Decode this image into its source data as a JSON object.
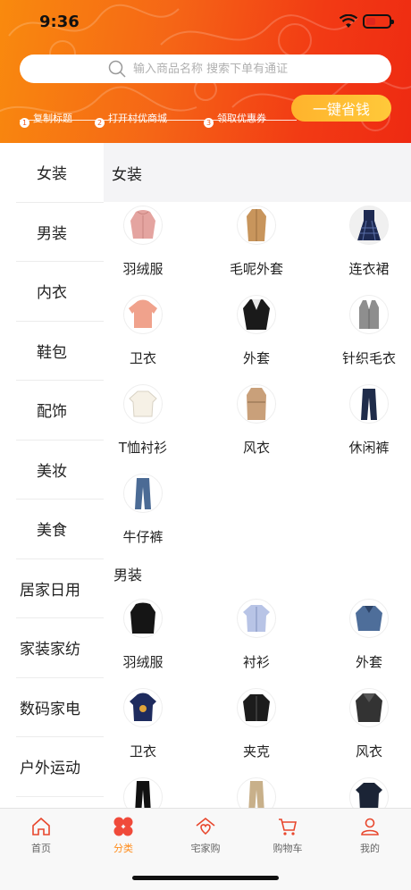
{
  "status": {
    "time": "9:36"
  },
  "search": {
    "placeholder": "输入商品名称 搜索下单有通证"
  },
  "steps": [
    {
      "num": "1",
      "label": "复制标题"
    },
    {
      "num": "2",
      "label": "打开村优商城"
    },
    {
      "num": "3",
      "label": "领取优惠券"
    }
  ],
  "save_button": "一键省钱",
  "sidebar": [
    "女装",
    "男装",
    "内衣",
    "鞋包",
    "配饰",
    "美妆",
    "美食",
    "居家日用",
    "家装家纺",
    "数码家电",
    "户外运动"
  ],
  "content": {
    "header": "女装",
    "sections": [
      {
        "title": "女装",
        "items": [
          {
            "label": "羽绒服",
            "icon": "pink-down-jacket-icon"
          },
          {
            "label": "毛呢外套",
            "icon": "camel-wool-coat-icon"
          },
          {
            "label": "连衣裙",
            "icon": "plaid-dress-icon"
          },
          {
            "label": "卫衣",
            "icon": "pink-hoodie-icon"
          },
          {
            "label": "外套",
            "icon": "black-jacket-icon"
          },
          {
            "label": "针织毛衣",
            "icon": "grey-knit-vest-icon"
          },
          {
            "label": "T恤衬衫",
            "icon": "white-shirt-icon"
          },
          {
            "label": "风衣",
            "icon": "trench-coat-icon"
          },
          {
            "label": "休闲裤",
            "icon": "navy-trousers-icon"
          },
          {
            "label": "牛仔裤",
            "icon": "jeans-icon"
          }
        ]
      },
      {
        "title": "男装",
        "items": [
          {
            "label": "羽绒服",
            "icon": "black-down-jacket-icon"
          },
          {
            "label": "衬衫",
            "icon": "blue-shirt-icon"
          },
          {
            "label": "外套",
            "icon": "denim-jacket-icon"
          },
          {
            "label": "卫衣",
            "icon": "navy-hoodie-icon"
          },
          {
            "label": "夹克",
            "icon": "black-bomber-icon"
          },
          {
            "label": "风衣",
            "icon": "dark-coat-icon"
          },
          {
            "label": "",
            "icon": "black-pants-icon"
          },
          {
            "label": "",
            "icon": "khaki-pants-icon"
          },
          {
            "label": "",
            "icon": "dark-sweater-icon"
          }
        ]
      }
    ]
  },
  "tabbar": [
    {
      "label": "首页",
      "icon": "home-icon"
    },
    {
      "label": "分类",
      "icon": "category-icon"
    },
    {
      "label": "宅家购",
      "icon": "house-heart-icon"
    },
    {
      "label": "购物车",
      "icon": "cart-icon"
    },
    {
      "label": "我的",
      "icon": "user-icon"
    }
  ],
  "colors": {
    "accent": "#ff8c1a",
    "header_start": "#f98a0e",
    "header_end": "#ee2a12",
    "button": "#ffb32c"
  }
}
